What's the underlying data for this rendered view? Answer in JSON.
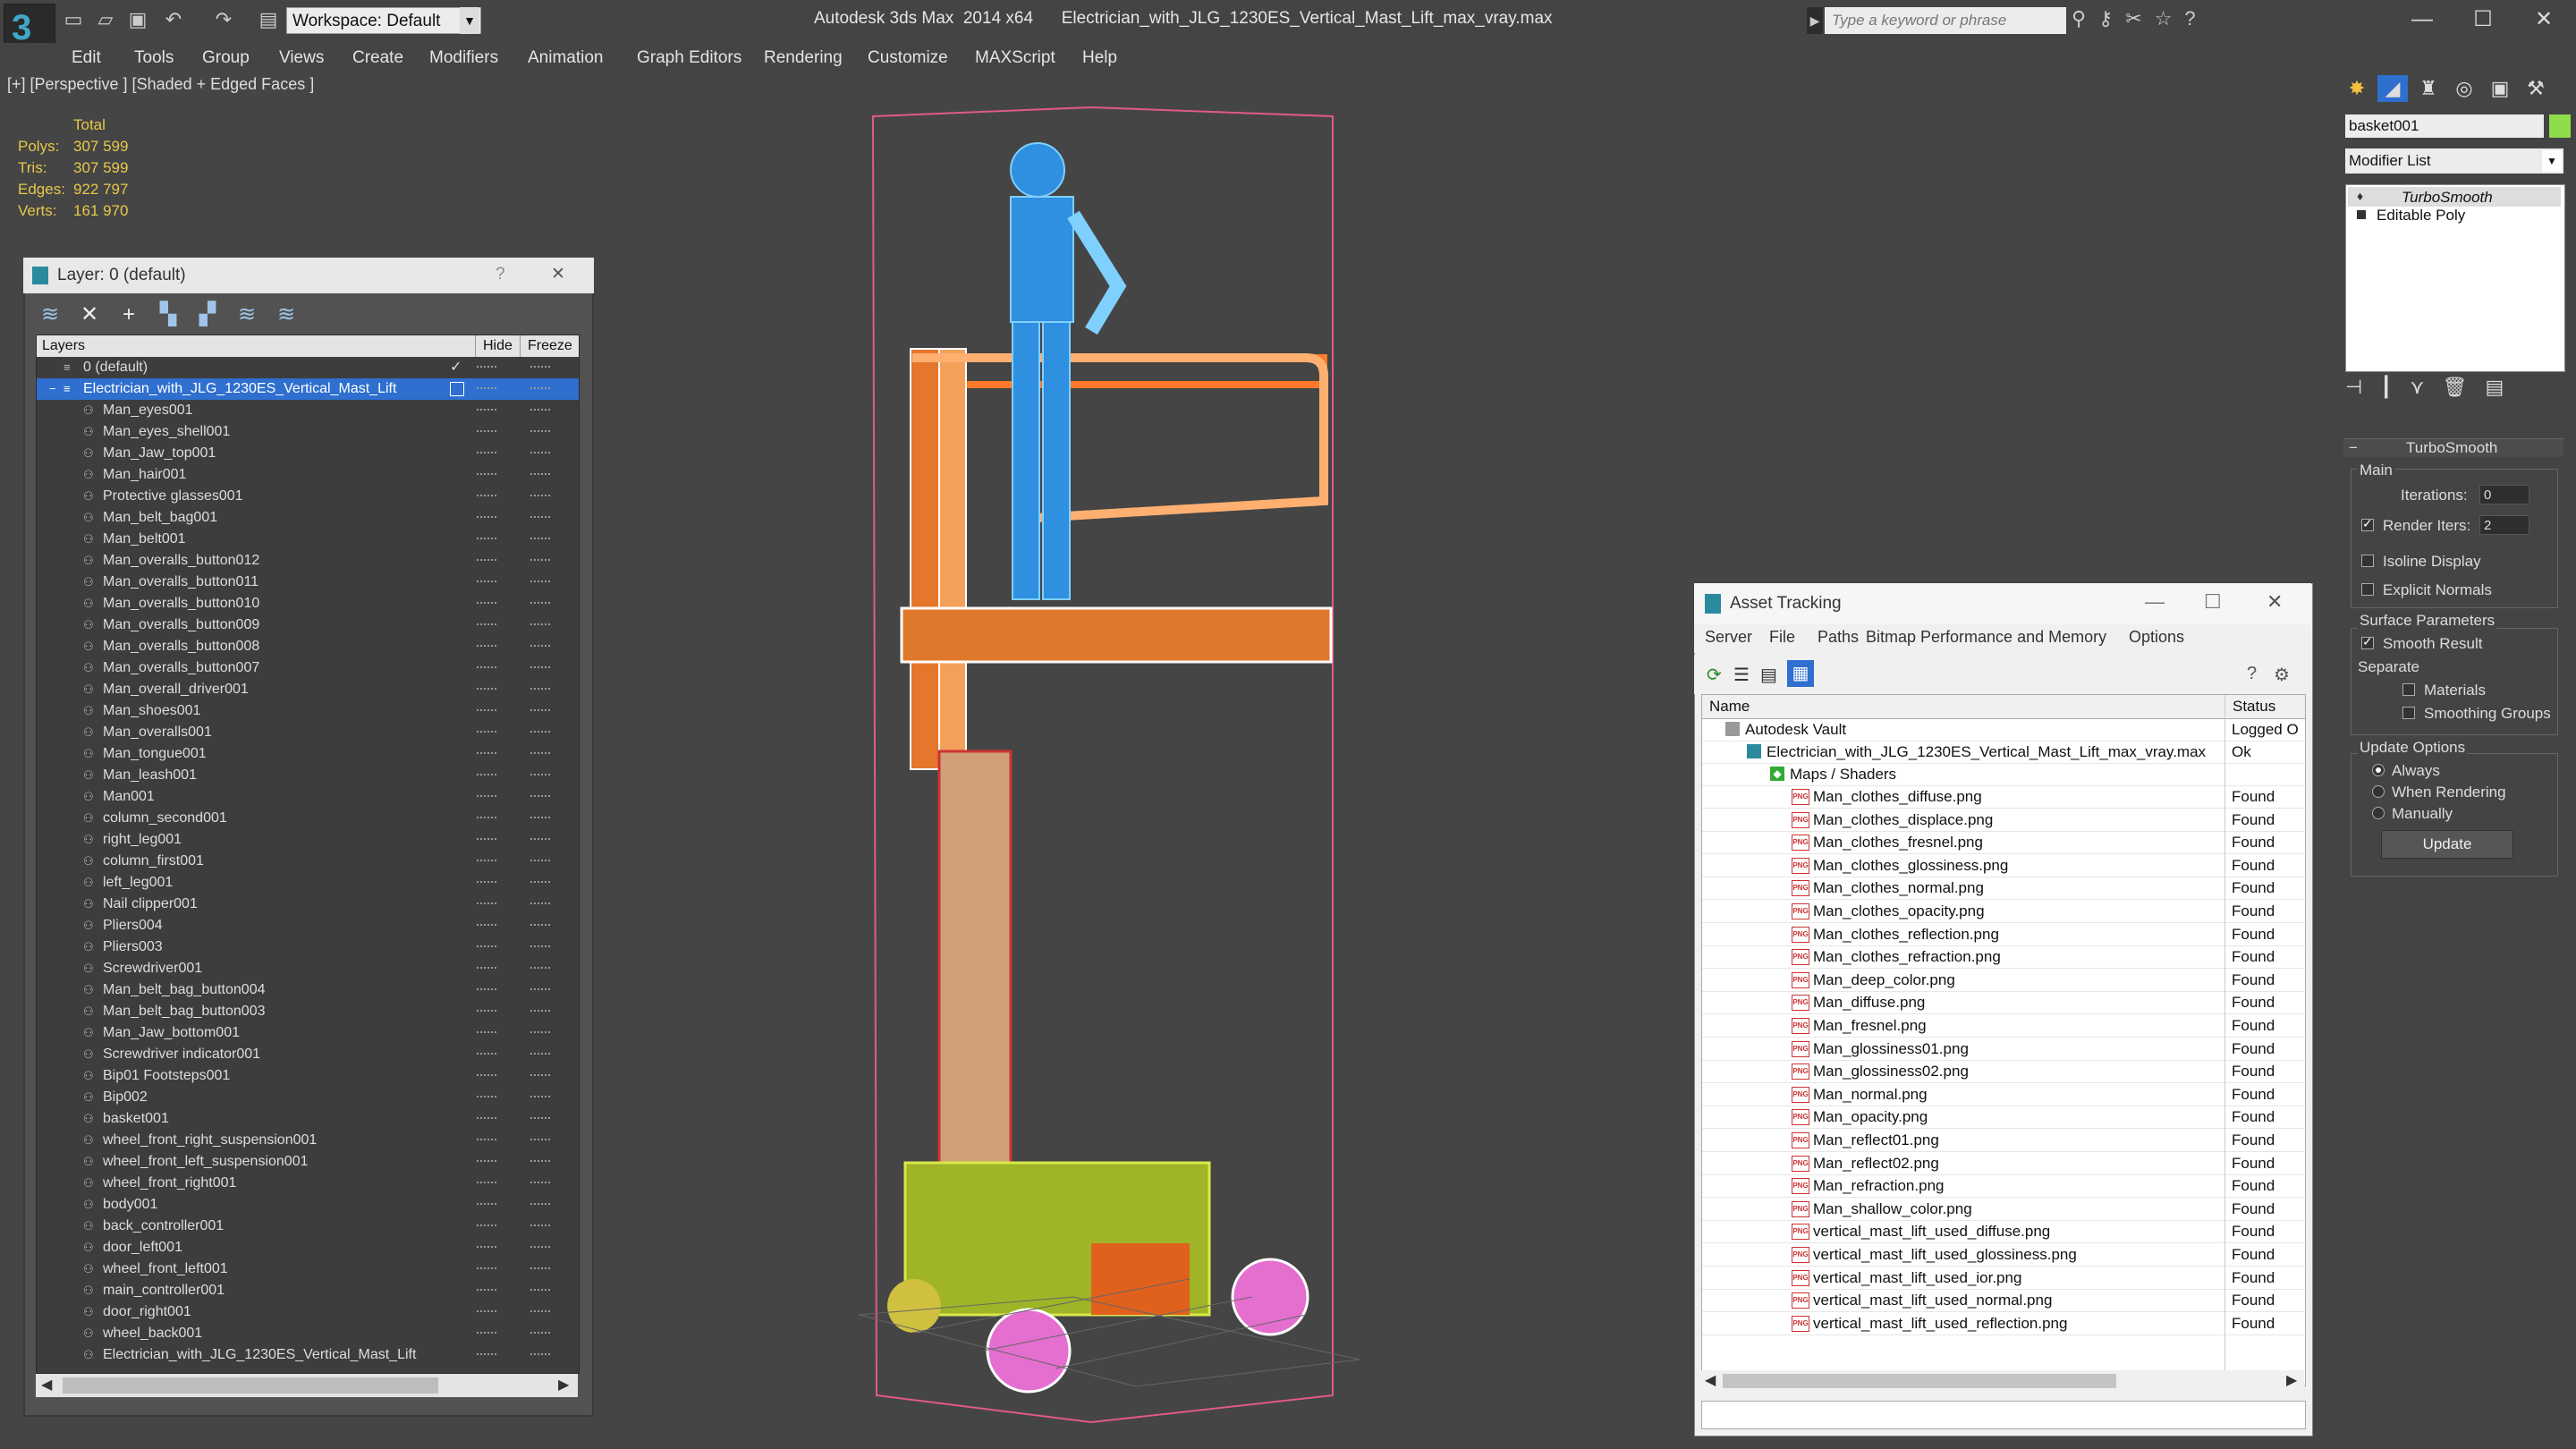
{
  "titlebar": {
    "workspace": "Workspace: Default",
    "app_title": "Autodesk 3ds Max  2014 x64      Electrician_with_JLG_1230ES_Vertical_Mast_Lift_max_vray.max",
    "search_placeholder": "Type a keyword or phrase",
    "minimize": "—",
    "maximize": "☐",
    "close": "✕"
  },
  "menubar": [
    "Edit",
    "Tools",
    "Group",
    "Views",
    "Create",
    "Modifiers",
    "Animation",
    "Graph Editors",
    "Rendering",
    "Customize",
    "MAXScript",
    "Help"
  ],
  "viewport": {
    "label": "[+] [Perspective ] [Shaded + Edged Faces ]",
    "stats": {
      "header": "Total",
      "rows": [
        {
          "label": "Polys:",
          "value": "307 599"
        },
        {
          "label": "Tris:",
          "value": "307 599"
        },
        {
          "label": "Edges:",
          "value": "922 797"
        },
        {
          "label": "Verts:",
          "value": "161 970"
        }
      ]
    }
  },
  "layer_panel": {
    "title": "Layer: 0 (default)",
    "help": "?",
    "close": "✕",
    "columns": {
      "layers": "Layers",
      "hide": "Hide",
      "freeze": "Freeze"
    },
    "default_layer": "0 (default)",
    "active_layer": "Electrician_with_JLG_1230ES_Vertical_Mast_Lift",
    "objects": [
      "Man_eyes001",
      "Man_eyes_shell001",
      "Man_Jaw_top001",
      "Man_hair001",
      "Protective glasses001",
      "Man_belt_bag001",
      "Man_belt001",
      "Man_overalls_button012",
      "Man_overalls_button011",
      "Man_overalls_button010",
      "Man_overalls_button009",
      "Man_overalls_button008",
      "Man_overalls_button007",
      "Man_overall_driver001",
      "Man_shoes001",
      "Man_overalls001",
      "Man_tongue001",
      "Man_leash001",
      "Man001",
      "column_second001",
      "right_leg001",
      "column_first001",
      "left_leg001",
      "Nail clipper001",
      "Pliers004",
      "Pliers003",
      "Screwdriver001",
      "Man_belt_bag_button004",
      "Man_belt_bag_button003",
      "Man_Jaw_bottom001",
      "Screwdriver indicator001",
      "Bip01 Footsteps001",
      "Bip002",
      "basket001",
      "wheel_front_right_suspension001",
      "wheel_front_left_suspension001",
      "wheel_front_right001",
      "body001",
      "back_controller001",
      "door_left001",
      "wheel_front_left001",
      "main_controller001",
      "door_right001",
      "wheel_back001",
      "Electrician_with_JLG_1230ES_Vertical_Mast_Lift"
    ]
  },
  "asset_tracking": {
    "title": "Asset Tracking",
    "menu": [
      "Server",
      "File",
      "Paths",
      "Bitmap Performance and Memory",
      "Options"
    ],
    "columns": {
      "name": "Name",
      "status": "Status"
    },
    "vault": {
      "name": "Autodesk Vault",
      "status": "Logged O"
    },
    "file": {
      "name": "Electrician_with_JLG_1230ES_Vertical_Mast_Lift_max_vray.max",
      "status": "Ok"
    },
    "group": "Maps / Shaders",
    "maps": [
      {
        "name": "Man_clothes_diffuse.png",
        "status": "Found"
      },
      {
        "name": "Man_clothes_displace.png",
        "status": "Found"
      },
      {
        "name": "Man_clothes_fresnel.png",
        "status": "Found"
      },
      {
        "name": "Man_clothes_glossiness.png",
        "status": "Found"
      },
      {
        "name": "Man_clothes_normal.png",
        "status": "Found"
      },
      {
        "name": "Man_clothes_opacity.png",
        "status": "Found"
      },
      {
        "name": "Man_clothes_reflection.png",
        "status": "Found"
      },
      {
        "name": "Man_clothes_refraction.png",
        "status": "Found"
      },
      {
        "name": "Man_deep_color.png",
        "status": "Found"
      },
      {
        "name": "Man_diffuse.png",
        "status": "Found"
      },
      {
        "name": "Man_fresnel.png",
        "status": "Found"
      },
      {
        "name": "Man_glossiness01.png",
        "status": "Found"
      },
      {
        "name": "Man_glossiness02.png",
        "status": "Found"
      },
      {
        "name": "Man_normal.png",
        "status": "Found"
      },
      {
        "name": "Man_opacity.png",
        "status": "Found"
      },
      {
        "name": "Man_reflect01.png",
        "status": "Found"
      },
      {
        "name": "Man_reflect02.png",
        "status": "Found"
      },
      {
        "name": "Man_refraction.png",
        "status": "Found"
      },
      {
        "name": "Man_shallow_color.png",
        "status": "Found"
      },
      {
        "name": "vertical_mast_lift_used_diffuse.png",
        "status": "Found"
      },
      {
        "name": "vertical_mast_lift_used_glossiness.png",
        "status": "Found"
      },
      {
        "name": "vertical_mast_lift_used_ior.png",
        "status": "Found"
      },
      {
        "name": "vertical_mast_lift_used_normal.png",
        "status": "Found"
      },
      {
        "name": "vertical_mast_lift_used_reflection.png",
        "status": "Found"
      }
    ]
  },
  "command_panel": {
    "object_name": "basket001",
    "object_color": "#8fdc4a",
    "modifier_list": "Modifier List",
    "stack": [
      "TurboSmooth",
      "Editable Poly"
    ],
    "rollout_title": "TurboSmooth",
    "main_group": "Main",
    "iterations_label": "Iterations:",
    "iterations_value": "0",
    "render_iters_label": "Render Iters:",
    "render_iters_value": "2",
    "isoline": "Isoline Display",
    "explicit_normals": "Explicit Normals",
    "surface_params": "Surface Parameters",
    "smooth_result": "Smooth Result",
    "separate": "Separate",
    "materials": "Materials",
    "smoothing_groups": "Smoothing Groups",
    "update_options": "Update Options",
    "always": "Always",
    "when_rendering": "When Rendering",
    "manually": "Manually",
    "update_button": "Update"
  }
}
